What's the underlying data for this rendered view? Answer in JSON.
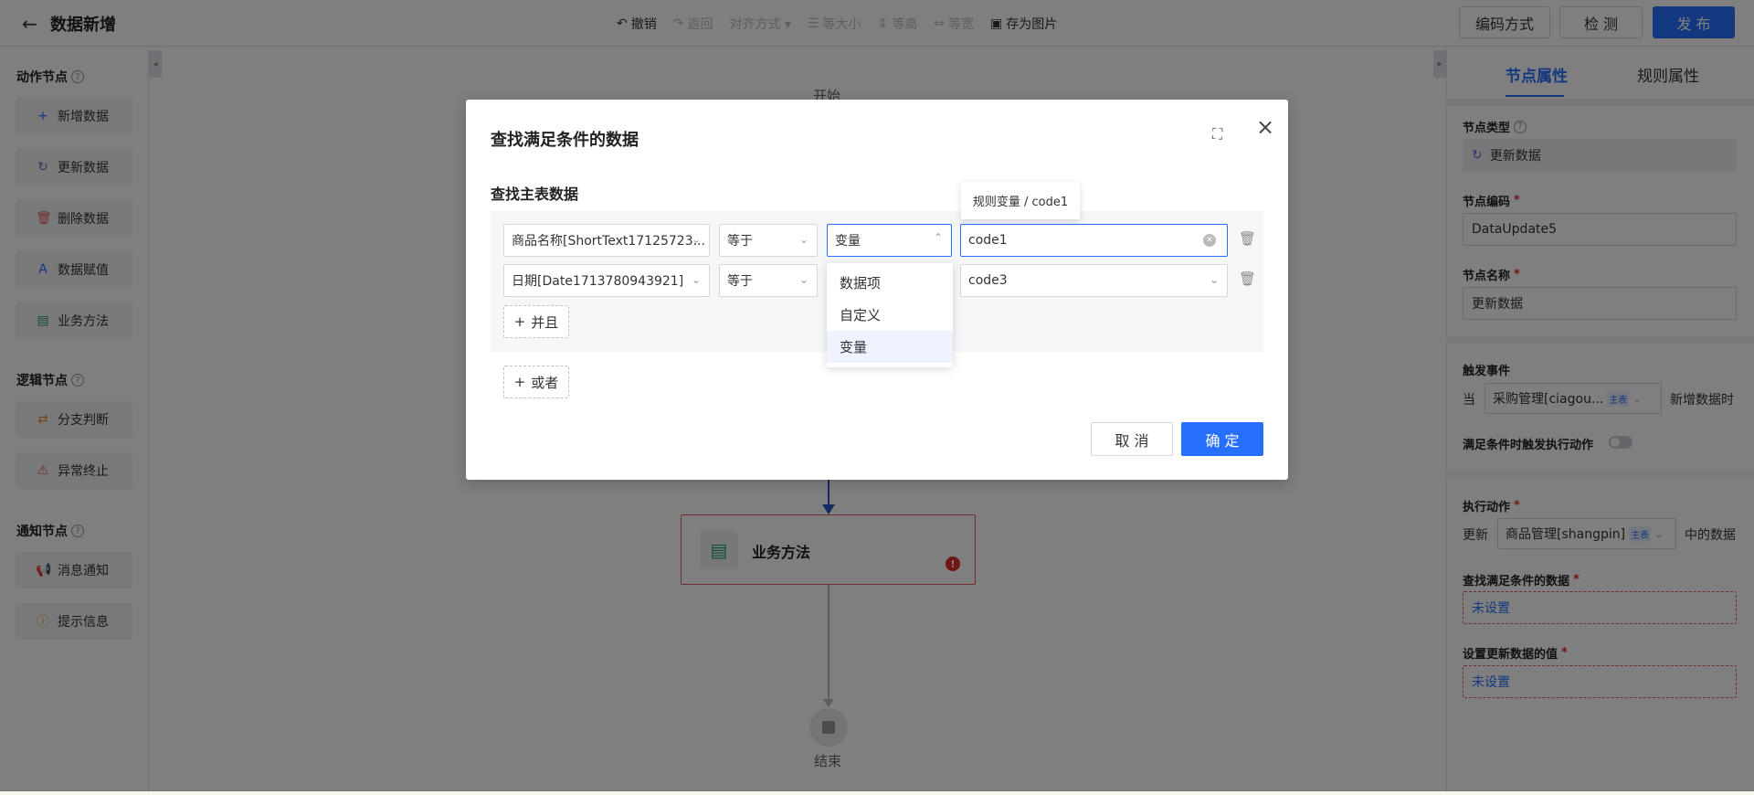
{
  "header": {
    "title": "数据新增",
    "toolbar": [
      {
        "icon": "undo-icon",
        "glyph": "↶",
        "label": "撤销",
        "enabled": true
      },
      {
        "icon": "redo-icon",
        "glyph": "↷",
        "label": "返回",
        "enabled": false
      },
      {
        "icon": "align-icon",
        "glyph": "",
        "label": "对齐方式 ▾",
        "enabled": false
      },
      {
        "icon": "same-size-icon",
        "glyph": "☰",
        "label": "等大小",
        "enabled": false
      },
      {
        "icon": "same-height-icon",
        "glyph": "⇕",
        "label": "等高",
        "enabled": false
      },
      {
        "icon": "same-width-icon",
        "glyph": "⇔",
        "label": "等宽",
        "enabled": false
      },
      {
        "icon": "image-icon",
        "glyph": "▣",
        "label": "存为图片",
        "enabled": true
      }
    ],
    "encode_label": "编码方式",
    "check_label": "检 测",
    "publish_label": "发 布"
  },
  "sidebar": {
    "action_title": "动作节点",
    "action_items": [
      {
        "label": "新增数据",
        "icon": "plus-icon",
        "glyph": "+",
        "color": "#2770ff"
      },
      {
        "label": "更新数据",
        "icon": "refresh-icon",
        "glyph": "↻",
        "color": "#6b6bd6"
      },
      {
        "label": "删除数据",
        "icon": "trash-icon",
        "glyph": "🗑",
        "color": "#e35d5d"
      },
      {
        "label": "数据赋值",
        "icon": "assign-icon",
        "glyph": "A",
        "color": "#2770ff"
      },
      {
        "label": "业务方法",
        "icon": "method-icon",
        "glyph": "▤",
        "color": "#29a069"
      }
    ],
    "logic_title": "逻辑节点",
    "logic_items": [
      {
        "label": "分支判断",
        "icon": "branch-icon",
        "glyph": "⇄",
        "color": "#e88b2c"
      },
      {
        "label": "异常终止",
        "icon": "warning-icon",
        "glyph": "⚠",
        "color": "#e35d5d"
      }
    ],
    "notify_title": "通知节点",
    "notify_items": [
      {
        "label": "消息通知",
        "icon": "megaphone-icon",
        "glyph": "📢",
        "color": "#2bb0c4"
      },
      {
        "label": "提示信息",
        "icon": "info-icon",
        "glyph": "ⓘ",
        "color": "#e8a72c"
      }
    ]
  },
  "canvas": {
    "start_label": "开始",
    "biz_node_label": "业务方法",
    "end_label": "结束"
  },
  "right_panel": {
    "tabs": [
      "节点属性",
      "规则属性"
    ],
    "active_tab": 0,
    "node_type_label": "节点类型",
    "node_type_value": "更新数据",
    "node_code_label": "节点编码",
    "node_code_value": "DataUpdate5",
    "node_name_label": "节点名称",
    "node_name_value": "更新数据",
    "trigger_label": "触发事件",
    "trigger_when": "当",
    "trigger_select": "采购管理[ciagou...",
    "trigger_tag": "主表",
    "trigger_suffix": "新增数据时",
    "cond_trigger_label": "满足条件时触发执行动作",
    "exec_label": "执行动作",
    "exec_prefix": "更新",
    "exec_select": "商品管理[shangpin]",
    "exec_tag": "主表",
    "exec_suffix": "中的数据",
    "find_label": "查找满足条件的数据",
    "find_value": "未设置",
    "set_label": "设置更新数据的值",
    "set_value": "未设置"
  },
  "modal": {
    "title": "查找满足条件的数据",
    "section_title": "查找主表数据",
    "rows": [
      {
        "field": "商品名称[ShortText17125723...",
        "operator": "等于",
        "type": "变量",
        "value": "code1"
      },
      {
        "field": "日期[Date1713780943921]",
        "operator": "等于",
        "type": "",
        "value": "code3"
      }
    ],
    "and_label": "并且",
    "or_label": "或者",
    "dropdown_options": [
      "数据项",
      "自定义",
      "变量"
    ],
    "dropdown_selected": 2,
    "tooltip": "规则变量 / code1",
    "cancel_label": "取 消",
    "ok_label": "确 定"
  }
}
